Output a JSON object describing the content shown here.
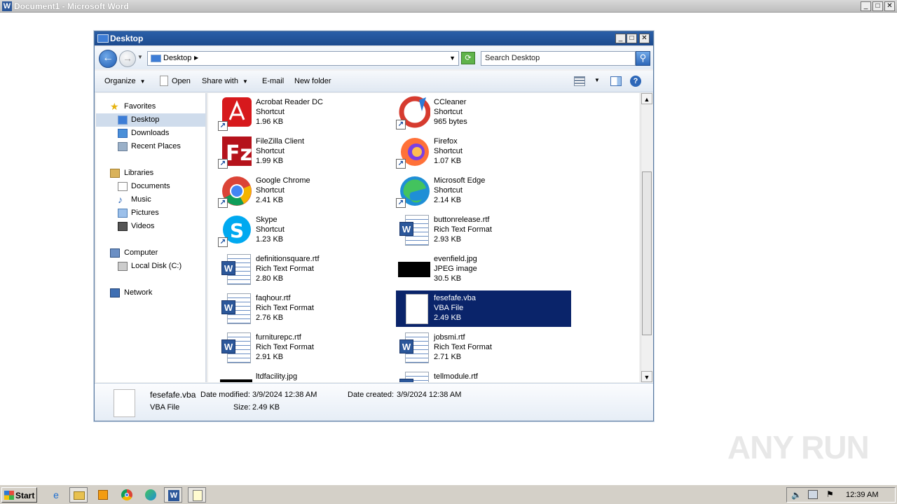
{
  "word": {
    "title": "Document1 - Microsoft Word",
    "icon": "W"
  },
  "explorer": {
    "title": "Desktop",
    "address": "Desktop",
    "search_placeholder": "Search Desktop",
    "toolbar": {
      "organize": "Organize",
      "open": "Open",
      "share_with": "Share with",
      "email": "E-mail",
      "new_folder": "New folder"
    },
    "nav": {
      "favorites": "Favorites",
      "desktop": "Desktop",
      "downloads": "Downloads",
      "recent_places": "Recent Places",
      "libraries": "Libraries",
      "documents": "Documents",
      "music": "Music",
      "pictures": "Pictures",
      "videos": "Videos",
      "computer": "Computer",
      "local_disk": "Local Disk (C:)",
      "network": "Network"
    },
    "files": [
      {
        "name": "Acrobat Reader DC",
        "type": "Shortcut",
        "size": "1.96 KB",
        "icon": "acrobat-icon"
      },
      {
        "name": "CCleaner",
        "type": "Shortcut",
        "size": "965 bytes",
        "icon": "ccleaner-icon"
      },
      {
        "name": "FileZilla Client",
        "type": "Shortcut",
        "size": "1.99 KB",
        "icon": "filezilla-icon"
      },
      {
        "name": "Firefox",
        "type": "Shortcut",
        "size": "1.07 KB",
        "icon": "firefox-icon"
      },
      {
        "name": "Google Chrome",
        "type": "Shortcut",
        "size": "2.41 KB",
        "icon": "chrome-icon"
      },
      {
        "name": "Microsoft Edge",
        "type": "Shortcut",
        "size": "2.14 KB",
        "icon": "edge-icon"
      },
      {
        "name": "Skype",
        "type": "Shortcut",
        "size": "1.23 KB",
        "icon": "skype-icon"
      },
      {
        "name": "buttonrelease.rtf",
        "type": "Rich Text Format",
        "size": "2.93 KB",
        "icon": "word-document-icon"
      },
      {
        "name": "definitionsquare.rtf",
        "type": "Rich Text Format",
        "size": "2.80 KB",
        "icon": "word-document-icon"
      },
      {
        "name": "evenfield.jpg",
        "type": "JPEG image",
        "size": "30.5 KB",
        "icon": "jpeg-thumbnail-icon"
      },
      {
        "name": "faqhour.rtf",
        "type": "Rich Text Format",
        "size": "2.76 KB",
        "icon": "word-document-icon"
      },
      {
        "name": "fesefafe.vba",
        "type": "VBA File",
        "size": "2.49 KB",
        "icon": "blank-file-icon",
        "selected": true
      },
      {
        "name": "furniturepc.rtf",
        "type": "Rich Text Format",
        "size": "2.91 KB",
        "icon": "word-document-icon"
      },
      {
        "name": "jobsmi.rtf",
        "type": "Rich Text Format",
        "size": "2.71 KB",
        "icon": "word-document-icon"
      },
      {
        "name": "ltdfacility.jpg",
        "type": "",
        "size": "",
        "icon": "jpeg-thumbnail-icon"
      },
      {
        "name": "tellmodule.rtf",
        "type": "",
        "size": "",
        "icon": "word-document-icon"
      }
    ],
    "details": {
      "name": "fesefafe.vba",
      "type": "VBA File",
      "modified_label": "Date modified:",
      "modified_value": "3/9/2024 12:38 AM",
      "created_label": "Date created:",
      "created_value": "3/9/2024 12:38 AM",
      "size_label": "Size:",
      "size_value": "2.49 KB"
    }
  },
  "taskbar": {
    "start": "Start",
    "clock": "12:39 AM"
  },
  "watermark": "ANY RUN"
}
